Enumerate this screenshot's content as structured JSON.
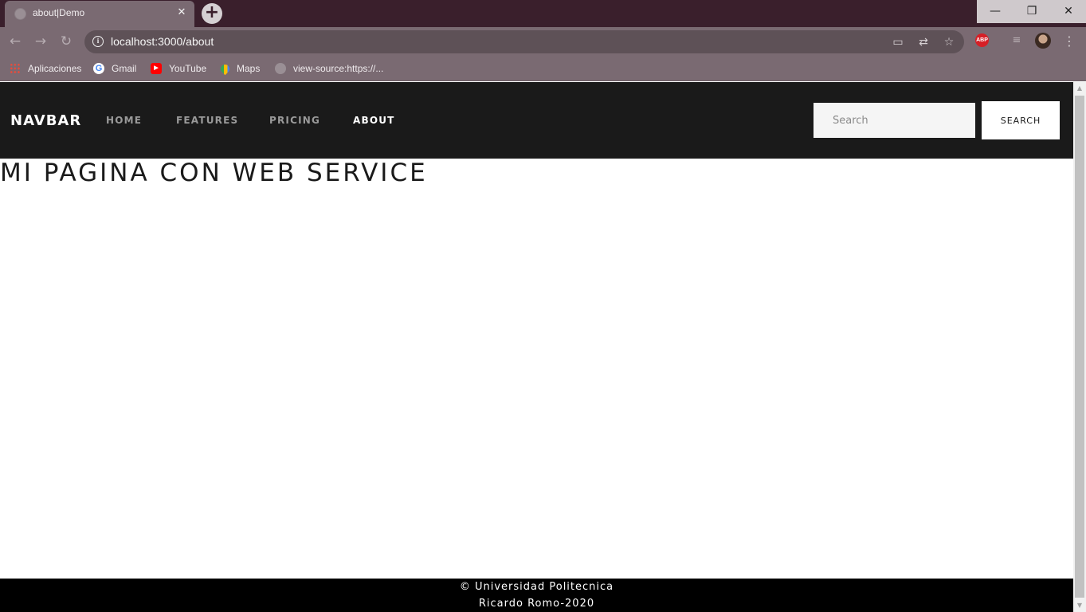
{
  "browser": {
    "tab": {
      "title": "about|Demo",
      "close": "✕"
    },
    "new_tab": "+",
    "window_controls": {
      "minimize": "—",
      "restore": "❐",
      "close": "✕"
    },
    "nav": {
      "back": "←",
      "forward": "→",
      "reload": "↻"
    },
    "address": {
      "info": "i",
      "url": "localhost:3000/about"
    },
    "address_icons": {
      "cast": "▭",
      "translate": "⇄",
      "bookmark": "☆"
    },
    "extensions": {
      "abp": "ABP",
      "media": "≡",
      "menu": "⋮"
    },
    "bookmarks": [
      {
        "label": "Aplicaciones",
        "icon": "apps-icon"
      },
      {
        "label": "Gmail",
        "icon": "google-icon"
      },
      {
        "label": "YouTube",
        "icon": "youtube-icon"
      },
      {
        "label": "Maps",
        "icon": "maps-icon"
      },
      {
        "label": "view-source:https://...",
        "icon": "globe-icon"
      }
    ]
  },
  "site": {
    "brand": "NAVBAR",
    "nav": [
      {
        "label": "HOME",
        "active": false
      },
      {
        "label": "FEATURES",
        "active": false
      },
      {
        "label": "PRICING",
        "active": false
      },
      {
        "label": "ABOUT",
        "active": true
      }
    ],
    "search": {
      "placeholder": "Search",
      "value": "",
      "button": "SEARCH"
    },
    "heading": "MI PAGINA CON WEB SERVICE",
    "footer": {
      "line1": "© Universidad Politecnica",
      "line2": "Ricardo Romo-2020"
    }
  },
  "colors": {
    "titlebar": "#3a1f2c",
    "toolbar": "#7a6a72",
    "navbar": "#1a1a1a",
    "footer": "#000000"
  }
}
